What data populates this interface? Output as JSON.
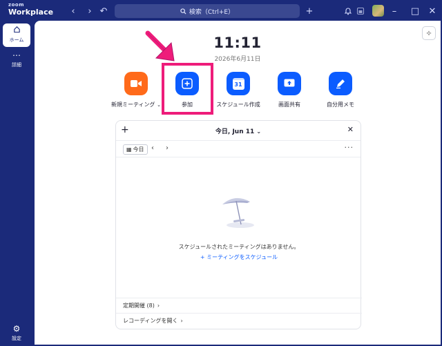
{
  "app": {
    "brand_top": "zoom",
    "brand_name": "Workplace"
  },
  "titlebar": {
    "back_glyph": "‹",
    "forward_glyph": "›",
    "history_glyph": "↶",
    "search_placeholder": "検索（Ctrl+E）",
    "plus_glyph": "+",
    "minimize_glyph": "–",
    "maximize_glyph": "□",
    "close_glyph": "✕"
  },
  "sidebar": {
    "items": [
      {
        "label": "ホーム",
        "icon": "home-icon"
      },
      {
        "label": "詳細",
        "icon": "more-icon"
      },
      {
        "label": "設定",
        "icon": "gear-icon"
      }
    ]
  },
  "home": {
    "time": "11:11",
    "date": "2026年6月11日",
    "actions": [
      {
        "label": "新規ミーティング",
        "color": "#ff6a1a",
        "icon": "video-camera-icon"
      },
      {
        "label": "参加",
        "color": "#0b5cff",
        "icon": "plus-icon"
      },
      {
        "label": "スケジュール作成",
        "color": "#0b5cff",
        "icon": "calendar-icon",
        "icon_text": "31"
      },
      {
        "label": "画面共有",
        "color": "#0b5cff",
        "icon": "share-screen-icon"
      },
      {
        "label": "自分用メモ",
        "color": "#0b5cff",
        "icon": "pen-note-icon"
      }
    ]
  },
  "calendar": {
    "header": "今日, Jun 11",
    "today_button": "今日",
    "empty_text": "スケジュールされたミーティングはありません。",
    "schedule_link": "ミーティングをスケジュール",
    "recurring": "定期開催 (8)",
    "recordings": "レコーディングを開く"
  },
  "annotation": {
    "color": "#ee1c7a"
  }
}
